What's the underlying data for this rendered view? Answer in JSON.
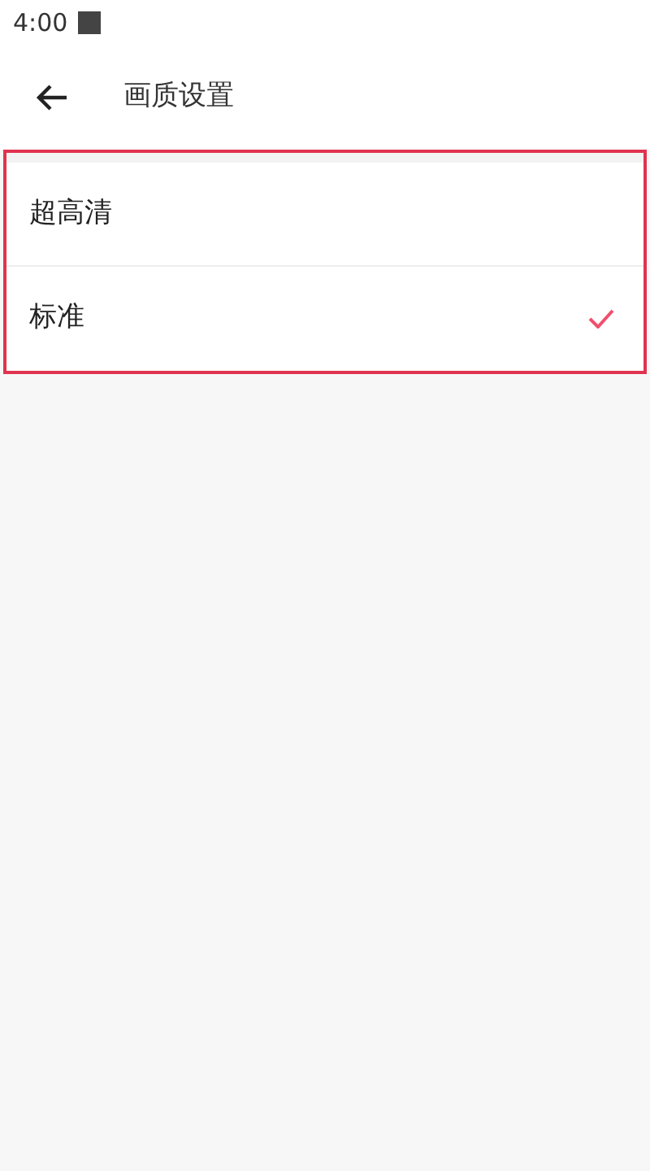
{
  "status_bar": {
    "time": "4:00"
  },
  "header": {
    "title": "画质设置"
  },
  "options": [
    {
      "label": "超高清",
      "selected": false
    },
    {
      "label": "标准",
      "selected": true
    }
  ]
}
